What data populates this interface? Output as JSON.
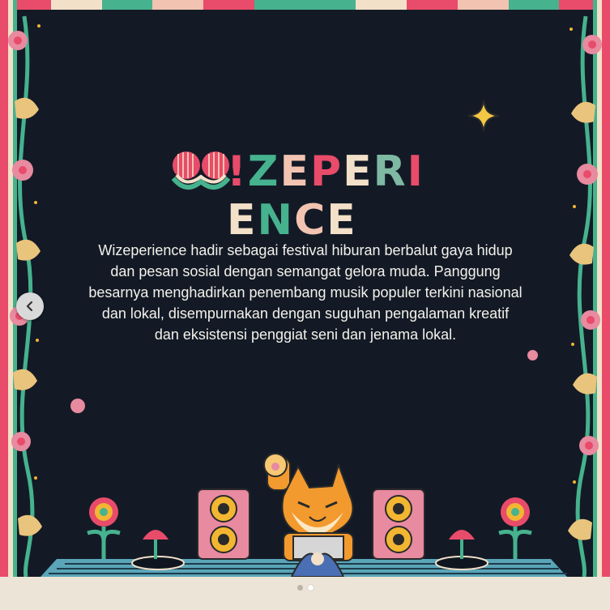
{
  "logo": {
    "text_letters": [
      "!",
      "Z",
      "E",
      "P",
      "E",
      "R",
      "I",
      "E",
      "N",
      "C",
      "E"
    ],
    "letter_colors": [
      "#e94b6a",
      "#46b28e",
      "#f1c3b0",
      "#e94b6a",
      "#f3e0c8",
      "#7fb8a3",
      "#e94b6a",
      "#f3e0c8",
      "#46b28e",
      "#f1c3b0",
      "#f3e0c8"
    ]
  },
  "description": {
    "lines": [
      "Wizeperience hadir sebagai festival hiburan berbalut gaya hidup",
      "dan pesan sosial dengan semangat gelora muda. Panggung",
      "besarnya menghadirkan penembang musik populer terkini nasional",
      "dan lokal, disempurnakan dengan suguhan pengalaman kreatif",
      "dan eksistensi penggiat seni dan jenama lokal."
    ]
  },
  "carousel": {
    "prev_icon": "chevron-left-icon",
    "slides_total": 2,
    "active_slide": 2
  },
  "colors": {
    "background": "#131a26",
    "pink": "#e94b6a",
    "teal": "#46b28e",
    "cream": "#f3e0c8",
    "gold": "#f2b632",
    "orange": "#f29a2e"
  }
}
